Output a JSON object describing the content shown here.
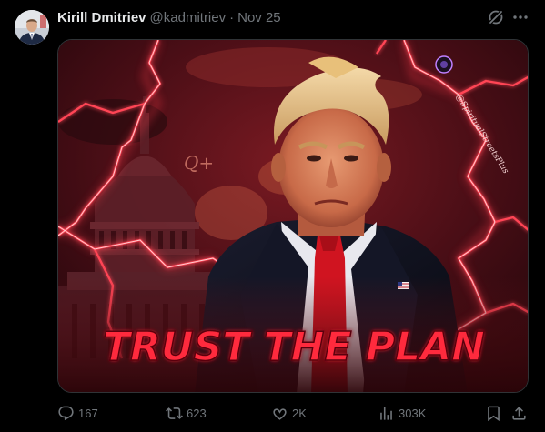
{
  "tweet": {
    "display_name": "Kirill Dmitriev",
    "handle": "@kadmitriev",
    "separator": "·",
    "date": "Nov 25"
  },
  "media": {
    "headline": "TRUST THE PLAN",
    "q_mark": "Q+",
    "watermark": "@SpiritualStreetsPlus"
  },
  "actions": {
    "replies": "167",
    "reposts": "623",
    "likes": "2K",
    "views": "303K"
  },
  "colors": {
    "background": "#000000",
    "text_primary": "#e7e9ea",
    "text_secondary": "#71767b",
    "lightning": "#ff2a3c"
  },
  "icons": [
    "avatar",
    "grok-icon",
    "more-icon",
    "reply-icon",
    "repost-icon",
    "like-icon",
    "views-icon",
    "bookmark-icon",
    "share-icon"
  ]
}
